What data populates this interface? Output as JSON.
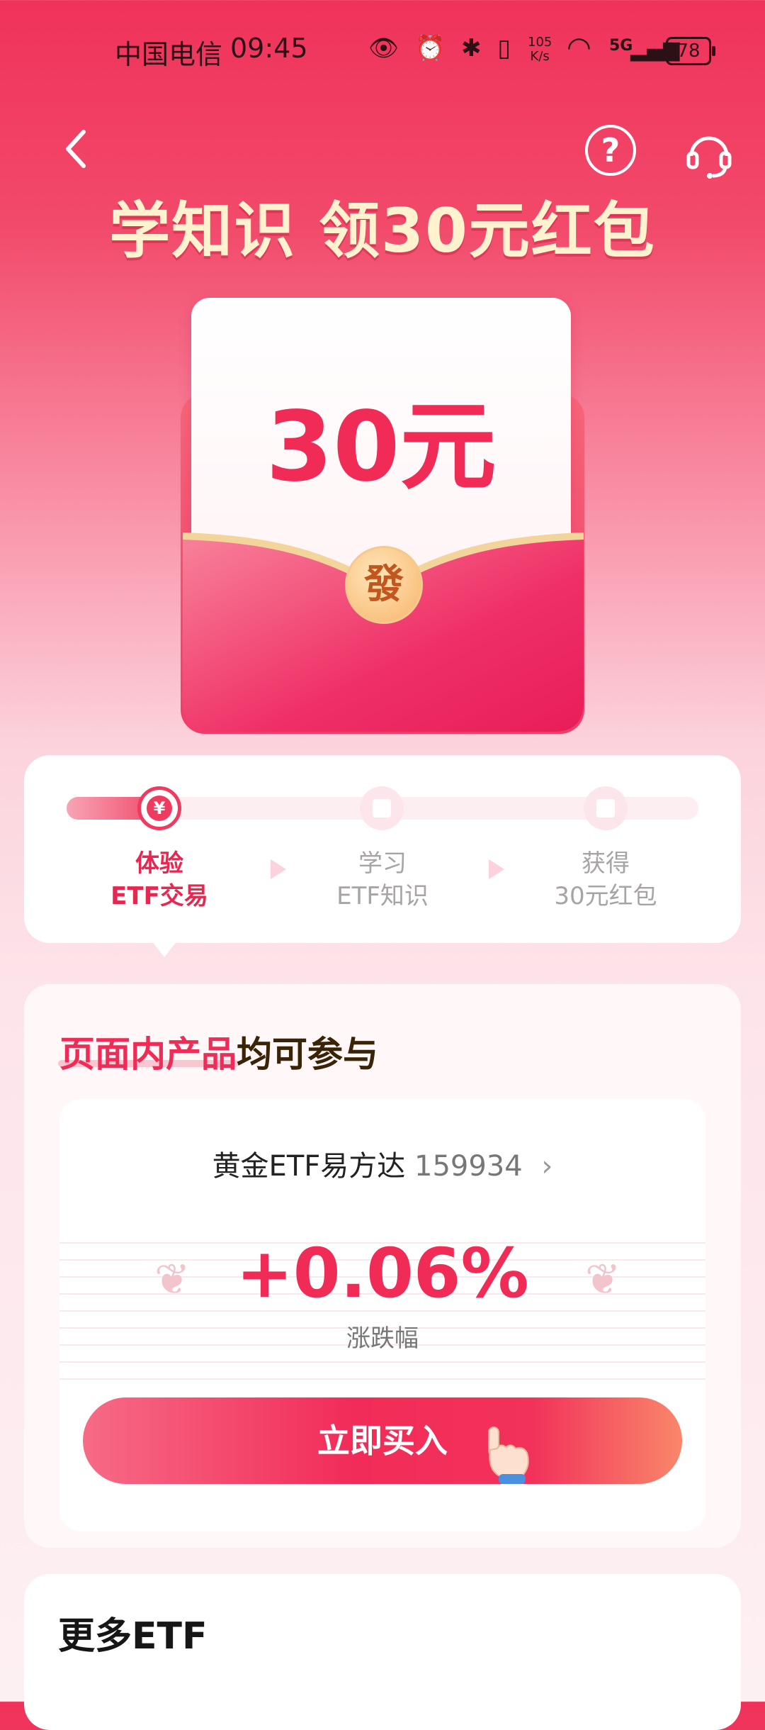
{
  "status_bar": {
    "carrier": "中国电信",
    "time": "09:45",
    "icons": "👁 ⏰ ✱ ▯",
    "speed_top": "105",
    "speed_bottom": "K/s",
    "network": "5G",
    "battery": "78"
  },
  "header": {
    "back_icon": "chevron-left-icon",
    "help_icon": "?",
    "service_icon": "headset-icon",
    "title": "学知识 领30元红包"
  },
  "envelope": {
    "amount": "30元",
    "seal": "發"
  },
  "progress": {
    "node1_symbol": "¥",
    "steps": [
      {
        "line1": "体验",
        "line2": "ETF交易",
        "active": true
      },
      {
        "line1": "学习",
        "line2": "ETF知识",
        "active": false
      },
      {
        "line1": "获得",
        "line2": "30元红包",
        "active": false
      }
    ]
  },
  "main": {
    "title_highlight": "页面内产品",
    "title_rest": "均可参与",
    "fund_name": "黄金ETF易方达",
    "fund_code": "159934",
    "chevron": "›",
    "change": "+0.06%",
    "change_label": "涨跌幅",
    "buy_button": "立即买入"
  },
  "more": {
    "title": "更多ETF"
  },
  "colors": {
    "accent": "#ef2b56",
    "title_gold": "#fff2cf"
  }
}
